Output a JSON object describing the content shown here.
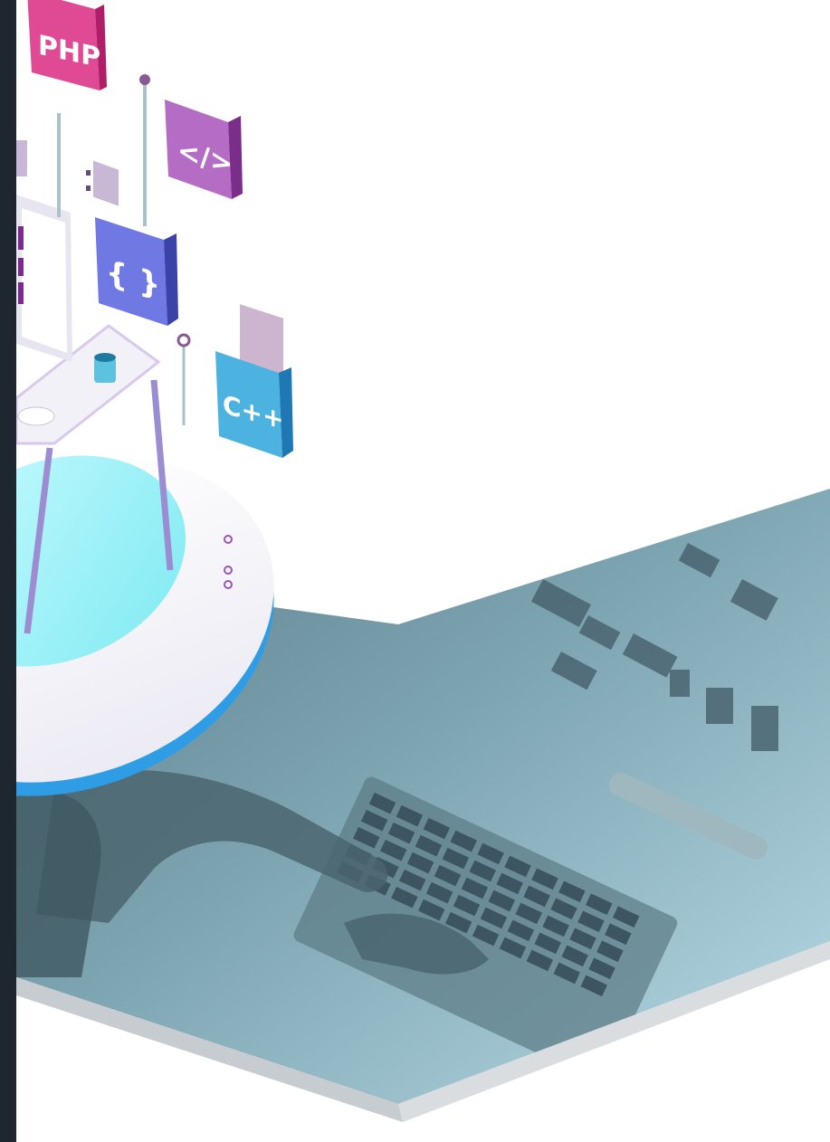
{
  "illustration": {
    "badges": [
      {
        "label": "PHP",
        "color": "#d8317f"
      },
      {
        "label": "</>",
        "color": "#a24bb1"
      },
      {
        "label": "{ }",
        "color": "#5663d6"
      },
      {
        "label": "C++",
        "color": "#2c9bd4"
      }
    ],
    "palette": {
      "dark_rail": "#1e2630",
      "photo_tint": "#6e97a5",
      "accent_blue": "#2f9de6",
      "platform": "#f4f3f8"
    }
  }
}
